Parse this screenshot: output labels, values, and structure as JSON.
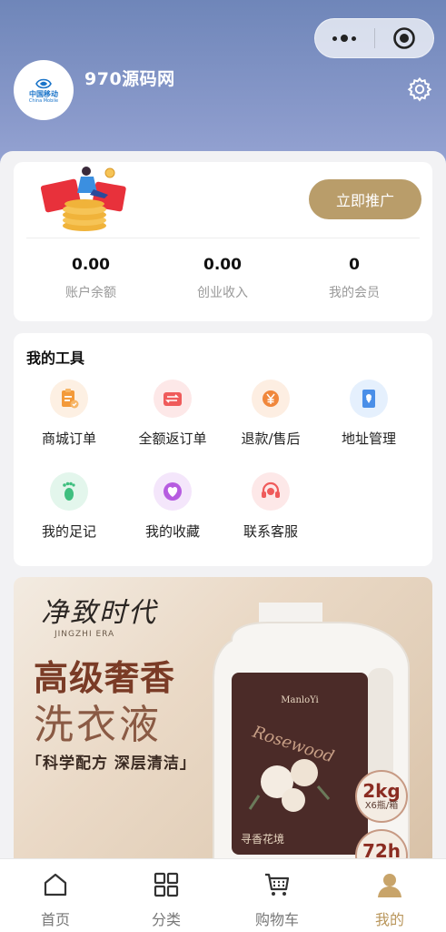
{
  "header": {
    "username": "970源码网",
    "avatar_logo": {
      "cn": "中国移动",
      "en": "China Mobile"
    }
  },
  "promo": {
    "button_label": "立即推广",
    "stats": [
      {
        "value": "0.00",
        "label": "账户余额"
      },
      {
        "value": "0.00",
        "label": "创业收入"
      },
      {
        "value": "0",
        "label": "我的会员"
      }
    ]
  },
  "tools": {
    "title": "我的工具",
    "items": [
      {
        "label": "商城订单",
        "icon": "clipboard-icon",
        "color": "#f39a3a",
        "bg": "#fdf0e3"
      },
      {
        "label": "全额返订单",
        "icon": "wallet-icon",
        "color": "#ef5b5b",
        "bg": "#fde8e8"
      },
      {
        "label": "退款/售后",
        "icon": "yen-refund-icon",
        "color": "#f0873c",
        "bg": "#fdeee2"
      },
      {
        "label": "地址管理",
        "icon": "address-icon",
        "color": "#4a8fe8",
        "bg": "#e5f0fd"
      },
      {
        "label": "我的足记",
        "icon": "footprint-icon",
        "color": "#3fbf7f",
        "bg": "#e3f6ec"
      },
      {
        "label": "我的收藏",
        "icon": "heart-icon",
        "color": "#b65ce0",
        "bg": "#f4e6fb"
      },
      {
        "label": "联系客服",
        "icon": "headset-icon",
        "color": "#ef5b5b",
        "bg": "#fde8e8"
      }
    ]
  },
  "banner": {
    "brand_cn": "净致时代",
    "brand_en": "JINGZHI ERA",
    "headline_1": "高级奢香",
    "headline_2": "洗衣液",
    "tagline": "「科学配方 深层清洁」",
    "badge_1_big": "2kg",
    "badge_1_small": "X6瓶/箱",
    "badge_2_big": "72h",
    "bottle_brand": "ManloYi",
    "bottle_script": "Rosewood",
    "bottle_label_cn": "寻香花境"
  },
  "tabbar": {
    "items": [
      {
        "label": "首页",
        "icon": "home-icon"
      },
      {
        "label": "分类",
        "icon": "grid-icon"
      },
      {
        "label": "购物车",
        "icon": "cart-icon"
      },
      {
        "label": "我的",
        "icon": "user-icon"
      }
    ],
    "active_index": 3,
    "active_color": "#b9965b"
  }
}
